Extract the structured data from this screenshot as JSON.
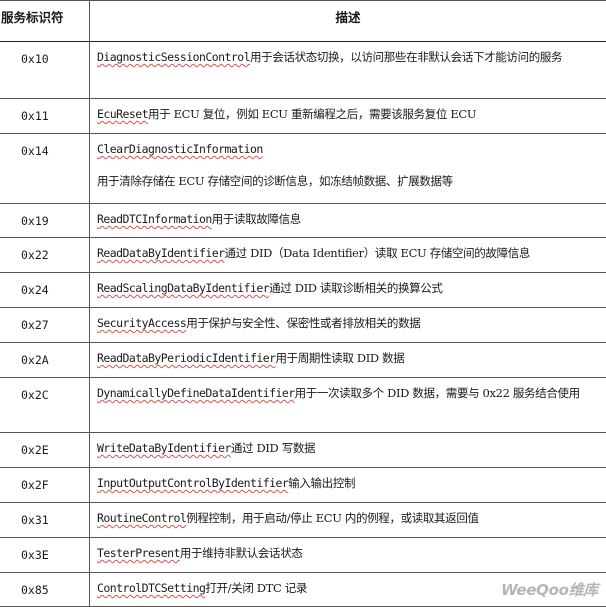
{
  "headers": {
    "code": "服务标识符",
    "description": "描述"
  },
  "rows": [
    {
      "code": "0x10",
      "name": "DiagnosticSessionControl",
      "text": "用于会话状态切换，以访问那些在非默认会话下才能访问的服务",
      "extra": ""
    },
    {
      "code": "0x11",
      "name": "EcuReset",
      "text": "用于 ECU 复位，例如 ECU 重新编程之后，需要该服务复位 ECU",
      "extra": ""
    },
    {
      "code": "0x14",
      "name": "ClearDiagnosticInformation",
      "text": "",
      "extra": "用于清除存储在 ECU 存储空间的诊断信息，如冻结帧数据、扩展数据等"
    },
    {
      "code": "0x19",
      "name": "ReadDTCInformation",
      "text": "用于读取故障信息",
      "extra": ""
    },
    {
      "code": "0x22",
      "name": "ReadDataByIdentifier",
      "text": "通过 DID（Data Identifier）读取 ECU 存储空间的故障信息",
      "extra": ""
    },
    {
      "code": "0x24",
      "name": "ReadScalingDataByIdentifier",
      "text": "通过 DID 读取诊断相关的换算公式",
      "extra": ""
    },
    {
      "code": "0x27",
      "name": "SecurityAccess",
      "text": "用于保护与安全性、保密性或者排放相关的数据",
      "extra": ""
    },
    {
      "code": "0x2A",
      "name": "ReadDataByPeriodicIdentifier",
      "text": "用于周期性读取 DID 数据",
      "extra": ""
    },
    {
      "code": "0x2C",
      "name": "DynamicallyDefineDataIdentifier",
      "text": "用于一次读取多个 DID 数据，需要与 0x22 服务结合使用",
      "extra": ""
    },
    {
      "code": "0x2E",
      "name": "WriteDataByIdentifier",
      "text": "通过 DID 写数据",
      "extra": ""
    },
    {
      "code": "0x2F",
      "name": "InputOutputControlByIdentifier",
      "text": "输入输出控制",
      "extra": ""
    },
    {
      "code": "0x31",
      "name": "RoutineControl",
      "text": "例程控制，用于启动/停止 ECU 内的例程，或读取其返回值",
      "extra": ""
    },
    {
      "code": "0x3E",
      "name": "TesterPresent",
      "text": "用于维持非默认会话状态",
      "extra": ""
    },
    {
      "code": "0x85",
      "name": "ControlDTCSetting",
      "text": "打开/关闭 DTC 记录",
      "extra": ""
    }
  ],
  "watermark": "WeeQoo维库"
}
